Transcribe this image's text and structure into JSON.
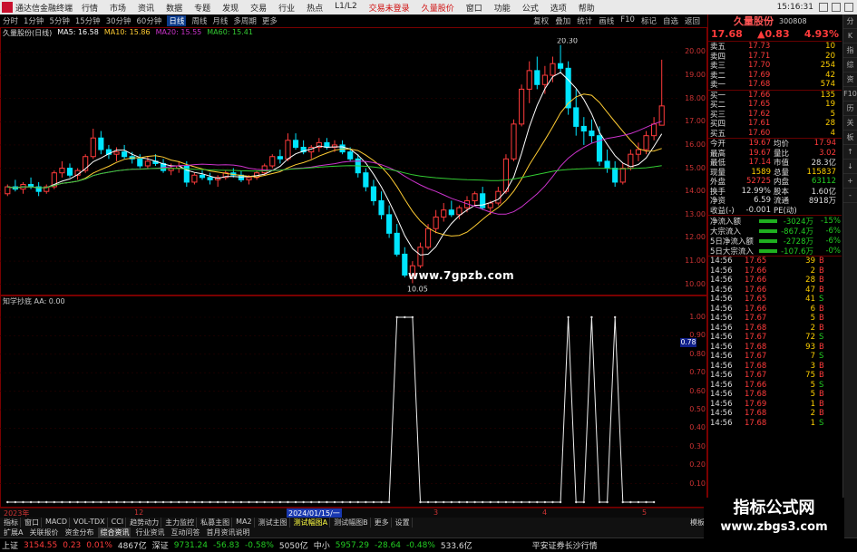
{
  "titlebar": {
    "app": "通达信金融终端",
    "menu": [
      "行情",
      "市场",
      "资讯",
      "数据",
      "专题",
      "发现",
      "交易",
      "行业",
      "热点",
      "L1/L2"
    ],
    "alerts": [
      "交易未登录",
      "久量股价"
    ],
    "right_menu": [
      "窗口",
      "功能",
      "公式",
      "选项",
      "帮助"
    ],
    "time": "15:16:31"
  },
  "toolbar": {
    "items": [
      "分时",
      "1分钟",
      "5分钟",
      "15分钟",
      "30分钟",
      "60分钟",
      "日线",
      "周线",
      "月线",
      "多周期",
      "更多"
    ],
    "active": "日线",
    "right": [
      "复权",
      "叠加",
      "统计",
      "画线",
      "F10",
      "标记",
      "自选",
      "返回"
    ]
  },
  "legend1": {
    "name": "久量股份(日线)",
    "ma5": "MA5: 16.58",
    "ma10": "MA10: 15.86",
    "ma20": "MA20: 15.55",
    "ma60": "MA60: 15.41"
  },
  "peak_label": "20.30",
  "low_label": "10.05",
  "yaxis1": [
    "20.00",
    "19.00",
    "18.00",
    "17.00",
    "16.00",
    "15.00",
    "14.00",
    "13.00",
    "12.00",
    "11.00",
    "10.00"
  ],
  "watermark_top": "www.7gpzb.com",
  "legend2": "知学抄底 AA: 0.00",
  "yaxis2": [
    "1.00",
    "0.90",
    "0.80",
    "0.70",
    "0.60",
    "0.50",
    "0.40",
    "0.30",
    "0.20",
    "0.10"
  ],
  "curval": "0.78",
  "xaxis": {
    "labels": [
      "2023年",
      "12",
      "2024/01/15/一",
      "3",
      "4",
      "5",
      "6"
    ]
  },
  "tabs": [
    "指标",
    "窗口",
    "MACD",
    "VOL-TDX",
    "CCI",
    "趋势动力",
    "主力监控",
    "私募主图",
    "MA2",
    "测试主图",
    "测试幅图A",
    "测试幅图B",
    "更多",
    "设置",
    "模板"
  ],
  "tabs_active": "测试幅图A",
  "tabs2": [
    "扩展A",
    "关联报价",
    "资金分布",
    "综合资讯",
    "行业资讯",
    "互动问答",
    "首月资讯说明"
  ],
  "tabs2_active": "综合资讯",
  "status": {
    "sh_label": "上证",
    "sh_val": "3154.55",
    "sh_chg": "0.23",
    "sh_pct": "0.01%",
    "sh_amt": "4867亿",
    "sz_label": "深证",
    "sz_val": "9731.24",
    "sz_chg": "-56.83",
    "sz_pct": "-0.58%",
    "sz_amt": "5050亿",
    "zx_label": "中小",
    "zx_val": "5957.29",
    "zx_chg": "-28.64",
    "zx_pct": "-0.48%",
    "zx_amt": "533.6亿",
    "broker": "平安证券长沙行情",
    "tail": "图文F10"
  },
  "stock": {
    "name": "久量股份",
    "code": "300808",
    "price": "17.68",
    "chg": "▲0.83",
    "pct": "4.93%"
  },
  "sell": [
    {
      "l": "卖五",
      "p": "17.73",
      "v": "10"
    },
    {
      "l": "卖四",
      "p": "17.71",
      "v": "20"
    },
    {
      "l": "卖三",
      "p": "17.70",
      "v": "254"
    },
    {
      "l": "卖二",
      "p": "17.69",
      "v": "42"
    },
    {
      "l": "卖一",
      "p": "17.68",
      "v": "574"
    }
  ],
  "buy": [
    {
      "l": "买一",
      "p": "17.66",
      "v": "135"
    },
    {
      "l": "买二",
      "p": "17.65",
      "v": "19"
    },
    {
      "l": "买三",
      "p": "17.62",
      "v": "5"
    },
    {
      "l": "买四",
      "p": "17.61",
      "v": "28"
    },
    {
      "l": "买五",
      "p": "17.60",
      "v": "4"
    }
  ],
  "stats": [
    {
      "a": "今开",
      "b": "19.67",
      "bc": "#ff3b3b",
      "c": "均价",
      "d": "17.94",
      "dc": "#ff3b3b"
    },
    {
      "a": "最高",
      "b": "19.67",
      "bc": "#ff3b3b",
      "c": "量比",
      "d": "3.02",
      "dc": "#ff3b3b"
    },
    {
      "a": "最低",
      "b": "17.14",
      "bc": "#ff3b3b",
      "c": "市值",
      "d": "28.3亿",
      "dc": "#ddd"
    },
    {
      "a": "现量",
      "b": "1589",
      "bc": "#ffd000",
      "c": "总量",
      "d": "115837",
      "dc": "#ffd000"
    },
    {
      "a": "外盘",
      "b": "52725",
      "bc": "#ff3b3b",
      "c": "内盘",
      "d": "63112",
      "dc": "#22cc22"
    },
    {
      "a": "换手",
      "b": "12.99%",
      "bc": "#ddd",
      "c": "股本",
      "d": "1.60亿",
      "dc": "#ddd"
    },
    {
      "a": "净资",
      "b": "6.59",
      "bc": "#ddd",
      "c": "流通",
      "d": "8918万",
      "dc": "#ddd"
    },
    {
      "a": "收益(-)",
      "b": "-0.001",
      "bc": "#ddd",
      "c": "PE(动)",
      "d": "",
      "dc": "#ddd"
    }
  ],
  "flows": [
    {
      "a": "净流入额",
      "b": "-3024万",
      "c": "-15%"
    },
    {
      "a": "大宗流入",
      "b": "-867.4万",
      "c": "-6%"
    },
    {
      "a": "5日净流入额",
      "b": "-2728万",
      "c": "-6%"
    },
    {
      "a": "5日大宗流入",
      "b": "-107.6万",
      "c": "-0%"
    }
  ],
  "ticks": [
    {
      "t": "14:56",
      "p": "17.65",
      "v": "39",
      "s": "B"
    },
    {
      "t": "14:56",
      "p": "17.66",
      "v": "2",
      "s": "B"
    },
    {
      "t": "14:56",
      "p": "17.66",
      "v": "28",
      "s": "B"
    },
    {
      "t": "14:56",
      "p": "17.66",
      "v": "47",
      "s": "B"
    },
    {
      "t": "14:56",
      "p": "17.65",
      "v": "41",
      "s": "S"
    },
    {
      "t": "14:56",
      "p": "17.66",
      "v": "6",
      "s": "B"
    },
    {
      "t": "14:56",
      "p": "17.67",
      "v": "5",
      "s": "B"
    },
    {
      "t": "14:56",
      "p": "17.68",
      "v": "2",
      "s": "B"
    },
    {
      "t": "14:56",
      "p": "17.67",
      "v": "72",
      "s": "S"
    },
    {
      "t": "14:56",
      "p": "17.68",
      "v": "93",
      "s": "B"
    },
    {
      "t": "14:56",
      "p": "17.67",
      "v": "7",
      "s": "S"
    },
    {
      "t": "14:56",
      "p": "17.68",
      "v": "3",
      "s": "B"
    },
    {
      "t": "14:56",
      "p": "17.67",
      "v": "75",
      "s": "B"
    },
    {
      "t": "14:56",
      "p": "17.66",
      "v": "5",
      "s": "S"
    },
    {
      "t": "14:56",
      "p": "17.68",
      "v": "5",
      "s": "B"
    },
    {
      "t": "14:56",
      "p": "17.69",
      "v": "1",
      "s": "B"
    },
    {
      "t": "14:56",
      "p": "17.68",
      "v": "2",
      "s": "B"
    },
    {
      "t": "14:56",
      "p": "17.68",
      "v": "1",
      "s": "S"
    }
  ],
  "sidebar": [
    "分",
    "K",
    "指",
    "综",
    "资",
    "F10",
    "历",
    "关",
    "板",
    "↑",
    "↓",
    "+",
    "-"
  ],
  "watermark_box": {
    "a": "指标公式网",
    "b": "www.zbgs3.com"
  },
  "colors": {
    "up": "#ff3b3b",
    "down": "#00e5ff",
    "ma5": "#ffffff",
    "ma10": "#ffcc33",
    "ma20": "#cc33cc",
    "ma60": "#33cc33",
    "grid": "#7a0000"
  },
  "kline_data": [
    [
      13.9,
      14.3,
      13.8,
      14.2
    ],
    [
      14.2,
      14.5,
      14.0,
      14.1
    ],
    [
      14.1,
      14.4,
      13.9,
      14.3
    ],
    [
      14.3,
      14.6,
      14.1,
      14.2
    ],
    [
      14.2,
      14.4,
      13.8,
      14.0
    ],
    [
      14.0,
      14.3,
      13.9,
      14.2
    ],
    [
      14.2,
      14.9,
      14.1,
      14.8
    ],
    [
      14.8,
      15.3,
      14.6,
      15.0
    ],
    [
      15.0,
      15.2,
      14.6,
      14.7
    ],
    [
      14.7,
      15.0,
      14.5,
      14.9
    ],
    [
      14.9,
      15.6,
      14.8,
      15.5
    ],
    [
      15.5,
      16.7,
      15.4,
      16.3
    ],
    [
      16.3,
      16.6,
      15.6,
      15.8
    ],
    [
      15.8,
      16.0,
      15.4,
      15.6
    ],
    [
      15.6,
      15.9,
      15.3,
      15.7
    ],
    [
      15.7,
      16.0,
      15.4,
      15.5
    ],
    [
      15.5,
      15.7,
      15.2,
      15.4
    ],
    [
      15.4,
      15.6,
      15.0,
      15.1
    ],
    [
      15.1,
      15.5,
      15.0,
      15.3
    ],
    [
      15.3,
      15.6,
      15.1,
      15.2
    ],
    [
      15.2,
      15.4,
      14.8,
      14.9
    ],
    [
      14.9,
      15.2,
      14.7,
      15.0
    ],
    [
      15.0,
      15.3,
      14.8,
      15.1
    ],
    [
      15.1,
      15.3,
      14.2,
      14.4
    ],
    [
      14.4,
      14.8,
      14.3,
      14.7
    ],
    [
      14.7,
      14.9,
      14.5,
      14.6
    ],
    [
      14.6,
      14.8,
      14.3,
      14.5
    ],
    [
      14.5,
      14.7,
      14.2,
      14.6
    ],
    [
      14.6,
      14.9,
      14.5,
      14.8
    ],
    [
      14.8,
      15.0,
      14.6,
      14.7
    ],
    [
      14.7,
      14.9,
      14.4,
      14.5
    ],
    [
      14.5,
      14.7,
      14.3,
      14.6
    ],
    [
      14.6,
      14.9,
      14.5,
      14.8
    ],
    [
      14.8,
      15.2,
      14.7,
      15.1
    ],
    [
      15.1,
      15.6,
      15.0,
      15.5
    ],
    [
      15.5,
      15.8,
      15.2,
      15.4
    ],
    [
      15.4,
      16.5,
      15.3,
      16.2
    ],
    [
      16.2,
      16.5,
      15.8,
      15.9
    ],
    [
      15.9,
      16.2,
      15.6,
      15.7
    ],
    [
      15.7,
      16.0,
      15.4,
      15.9
    ],
    [
      15.9,
      16.3,
      15.7,
      16.1
    ],
    [
      16.1,
      16.3,
      15.8,
      15.9
    ],
    [
      15.9,
      16.2,
      15.7,
      16.0
    ],
    [
      16.0,
      16.2,
      15.6,
      15.7
    ],
    [
      15.7,
      15.9,
      15.3,
      15.4
    ],
    [
      15.4,
      15.6,
      14.6,
      14.8
    ],
    [
      14.8,
      15.0,
      14.0,
      14.2
    ],
    [
      14.2,
      14.5,
      13.4,
      13.6
    ],
    [
      13.6,
      14.0,
      12.8,
      13.0
    ],
    [
      13.0,
      13.4,
      12.0,
      12.2
    ],
    [
      12.2,
      12.6,
      11.2,
      11.3
    ],
    [
      11.3,
      11.6,
      10.3,
      10.4
    ],
    [
      10.4,
      11.0,
      10.05,
      10.8
    ],
    [
      10.8,
      11.8,
      10.7,
      11.6
    ],
    [
      11.6,
      12.6,
      11.5,
      12.4
    ],
    [
      12.4,
      13.2,
      12.2,
      12.9
    ],
    [
      12.9,
      13.5,
      12.7,
      13.2
    ],
    [
      13.2,
      13.6,
      12.9,
      13.0
    ],
    [
      13.0,
      13.4,
      12.8,
      13.3
    ],
    [
      13.3,
      13.8,
      13.1,
      13.6
    ],
    [
      13.6,
      14.0,
      13.4,
      13.9
    ],
    [
      13.9,
      14.2,
      13.2,
      13.3
    ],
    [
      13.3,
      13.6,
      13.0,
      13.5
    ],
    [
      13.5,
      14.2,
      13.4,
      14.0
    ],
    [
      14.0,
      15.6,
      13.9,
      15.4
    ],
    [
      15.4,
      17.1,
      15.3,
      16.9
    ],
    [
      16.9,
      18.6,
      16.8,
      18.4
    ],
    [
      18.4,
      19.6,
      17.8,
      19.2
    ],
    [
      19.2,
      19.8,
      18.4,
      18.6
    ],
    [
      18.6,
      19.4,
      18.2,
      19.0
    ],
    [
      19.0,
      19.8,
      18.7,
      19.5
    ],
    [
      19.5,
      20.3,
      19.1,
      19.3
    ],
    [
      19.3,
      19.6,
      17.3,
      17.6
    ],
    [
      17.6,
      18.4,
      16.4,
      16.8
    ],
    [
      16.8,
      17.2,
      16.0,
      16.6
    ],
    [
      16.6,
      17.1,
      16.1,
      16.4
    ],
    [
      16.4,
      16.8,
      15.1,
      15.3
    ],
    [
      15.3,
      15.8,
      14.8,
      15.0
    ],
    [
      15.0,
      15.3,
      14.2,
      14.4
    ],
    [
      14.4,
      15.2,
      14.3,
      15.0
    ],
    [
      15.0,
      15.8,
      14.9,
      15.6
    ],
    [
      15.6,
      16.1,
      15.3,
      15.8
    ],
    [
      15.8,
      16.6,
      15.6,
      16.4
    ],
    [
      16.4,
      17.2,
      16.2,
      16.9
    ],
    [
      16.85,
      19.67,
      17.14,
      17.68
    ]
  ],
  "ind_data": [
    0,
    0,
    0,
    0,
    0,
    0,
    0,
    0,
    0,
    0,
    0,
    0,
    0,
    0,
    0,
    0,
    0,
    0,
    0,
    0,
    0,
    0,
    0,
    0,
    0,
    0,
    0,
    0,
    0,
    0,
    0,
    0,
    0,
    0,
    0,
    0,
    0,
    0,
    0,
    0,
    0,
    0,
    0,
    0,
    0,
    0,
    0,
    0,
    0,
    0,
    1,
    1,
    1,
    0,
    0,
    0,
    0,
    0,
    0,
    0,
    0,
    0,
    0,
    0,
    0,
    0,
    0,
    0,
    0,
    0,
    0,
    0,
    1,
    0,
    0,
    1,
    0,
    0,
    1,
    0,
    0,
    0,
    0,
    0
  ]
}
